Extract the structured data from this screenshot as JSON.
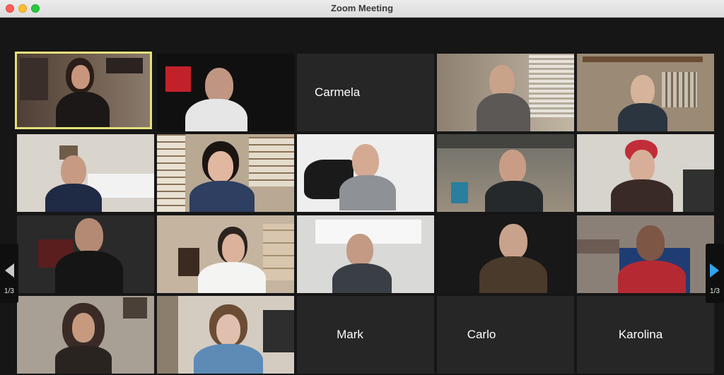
{
  "window": {
    "title": "Zoom Meeting"
  },
  "navigation": {
    "prev_label": "1/3",
    "next_label": "1/3"
  },
  "participants": [
    {
      "name": "",
      "has_video": true
    },
    {
      "name": "",
      "has_video": true
    },
    {
      "name": "Carmela",
      "has_video": false
    },
    {
      "name": "",
      "has_video": true
    },
    {
      "name": "",
      "has_video": true
    },
    {
      "name": "",
      "has_video": true
    },
    {
      "name": "",
      "has_video": true
    },
    {
      "name": "",
      "has_video": true
    },
    {
      "name": "",
      "has_video": true
    },
    {
      "name": "",
      "has_video": true
    },
    {
      "name": "",
      "has_video": true
    },
    {
      "name": "",
      "has_video": true
    },
    {
      "name": "",
      "has_video": true
    },
    {
      "name": "",
      "has_video": true
    },
    {
      "name": "",
      "has_video": true
    },
    {
      "name": "",
      "has_video": true
    },
    {
      "name": "",
      "has_video": true
    },
    {
      "name": "Mark",
      "has_video": false
    },
    {
      "name": "Carlo",
      "has_video": false
    },
    {
      "name": "Karolina",
      "has_video": false
    }
  ]
}
